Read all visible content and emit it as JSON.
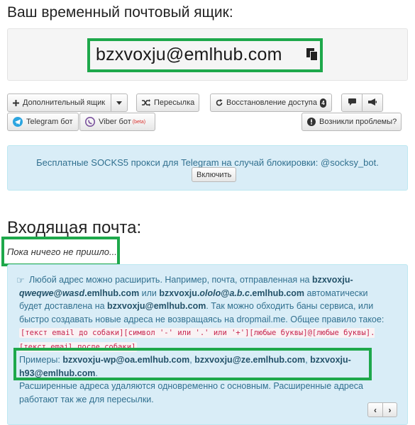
{
  "header": {
    "title": "Ваш временный почтовый ящик:"
  },
  "mailbox": {
    "address": "bzxvoxju@emlhub.com",
    "copy_icon": "copy-icon"
  },
  "toolbar": {
    "additional_box": "Дополнительный ящик",
    "forwarding": "Пересылка",
    "restore_access": "Восстановление доступа",
    "restore_badge": "4",
    "telegram_bot": "Telegram бот",
    "viber_bot": "Viber бот",
    "viber_beta": "(beta)",
    "problems": "Возникли проблемы?"
  },
  "proxy_notice": {
    "text": "Бесплатные SOCKS5 прокси для Telegram на случай блокировки: @socksy_bot.",
    "enable_label": "Включить"
  },
  "inbox": {
    "title": "Входящая почта:",
    "empty_text": "Пока ничего не пришло..."
  },
  "help": {
    "t1": "Любой адрес можно расширить. Например, почта, отправленная на ",
    "ex1a": "bzxvoxju-",
    "ex1b": "qweqwe",
    "ex1c": "@",
    "ex1d": "wasd",
    "ex1e": ".emlhub.com",
    "t2": " или ",
    "ex2a": "bzxvoxju.",
    "ex2b": "ololo",
    "ex2c": "@",
    "ex2d": "a.b.c",
    "ex2e": ".emlhub.com",
    "t3": " автоматически будет доставлена на ",
    "base": "bzxvoxju@emlhub.com",
    "t4": ". Так можно обходить баны сервиса, или быстро создавать новые адреса не возвращаясь на dropmail.me. Общее правило такое: ",
    "rule": "[текст email до собаки][символ '-' или '.' или '+'][любые буквы]@[любые буквы].[текст email после собаки]",
    "t5": ".",
    "examples_label": "Примеры: ",
    "example1": "bzxvoxju-wp@oa.emlhub.com",
    "sep1": ", ",
    "example2": "bzxvoxju@ze.emlhub.com",
    "sep2": ", ",
    "example3": "bzxvoxju-h93@emlhub.com",
    "t6": ".",
    "t7": "Расширенные адреса удаляются одновременно с основным. Расширенные адреса работают так же для пересылки."
  },
  "pager": {
    "prev": "‹",
    "next": "›"
  }
}
